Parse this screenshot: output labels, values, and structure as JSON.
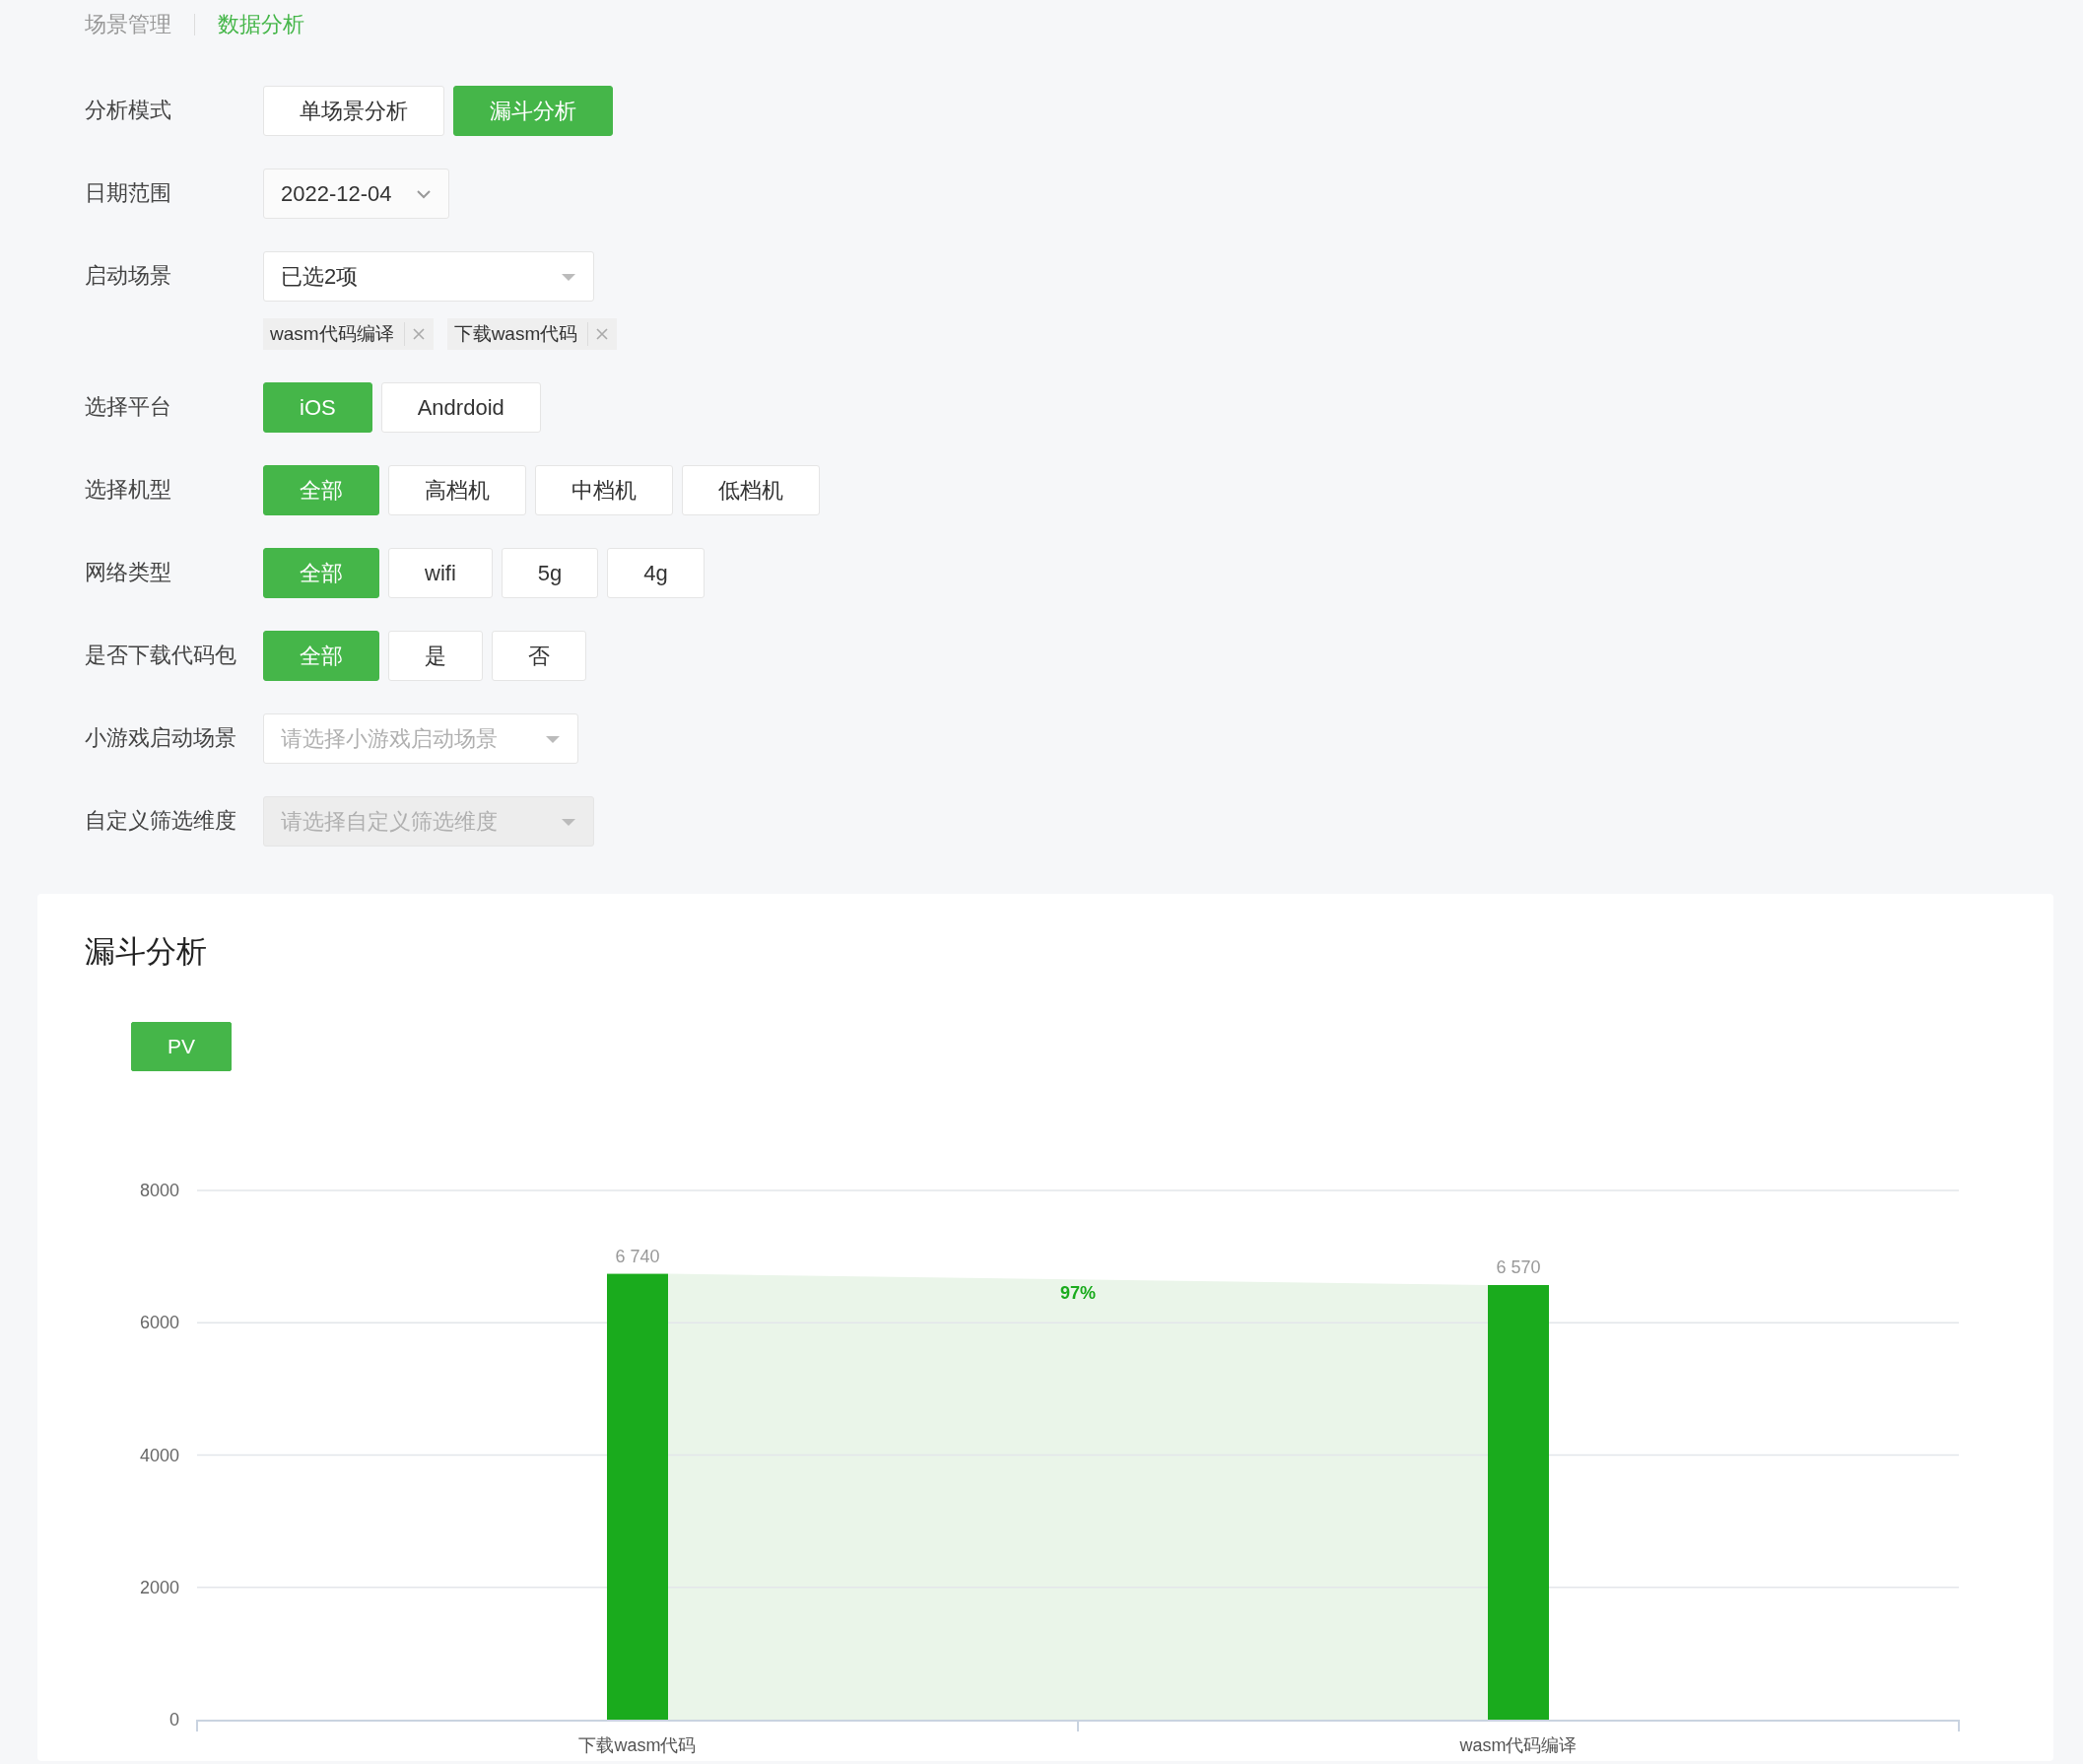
{
  "breadcrumb": [
    {
      "label": "场景管理",
      "selected": false
    },
    {
      "label": "数据分析",
      "selected": true
    }
  ],
  "filters": [
    {
      "kind": "segmented",
      "label": "分析模式",
      "options": [
        {
          "label": "单场景分析",
          "selected": false
        },
        {
          "label": "漏斗分析",
          "selected": true
        }
      ]
    },
    {
      "kind": "date",
      "label": "日期范围",
      "value": "2022-12-04"
    },
    {
      "kind": "multiselect",
      "label": "启动场景",
      "value": "已选2项",
      "tags": [
        "wasm代码编译",
        "下载wasm代码"
      ]
    },
    {
      "kind": "segmented",
      "label": "选择平台",
      "options": [
        {
          "label": "iOS",
          "selected": true
        },
        {
          "label": "Andrdoid",
          "selected": false
        }
      ]
    },
    {
      "kind": "segmented",
      "label": "选择机型",
      "options": [
        {
          "label": "全部",
          "selected": true
        },
        {
          "label": "高档机",
          "selected": false
        },
        {
          "label": "中档机",
          "selected": false
        },
        {
          "label": "低档机",
          "selected": false
        }
      ]
    },
    {
      "kind": "segmented",
      "label": "网络类型",
      "options": [
        {
          "label": "全部",
          "selected": true
        },
        {
          "label": "wifi",
          "selected": false
        },
        {
          "label": "5g",
          "selected": false
        },
        {
          "label": "4g",
          "selected": false
        }
      ]
    },
    {
      "kind": "segmented",
      "label": "是否下载代码包",
      "options": [
        {
          "label": "全部",
          "selected": true
        },
        {
          "label": "是",
          "selected": false
        },
        {
          "label": "否",
          "selected": false
        }
      ]
    },
    {
      "kind": "select",
      "label": "小游戏启动场景",
      "placeholder": "请选择小游戏启动场景",
      "disabled": false
    },
    {
      "kind": "select",
      "label": "自定义筛选维度",
      "placeholder": "请选择自定义筛选维度",
      "disabled": true
    }
  ],
  "funnel": {
    "title": "漏斗分析",
    "metric_tabs": [
      {
        "label": "PV",
        "selected": true
      }
    ],
    "chart_data": {
      "type": "bar",
      "categories": [
        "下载wasm代码",
        "wasm代码编译"
      ],
      "values": [
        6740,
        6570
      ],
      "grid": true,
      "ylim": [
        0,
        8000
      ],
      "yticks": [
        0,
        2000,
        4000,
        6000,
        8000
      ],
      "value_labels": [
        "6 740",
        "6 570"
      ],
      "annotations": [
        "97%"
      ]
    }
  }
}
